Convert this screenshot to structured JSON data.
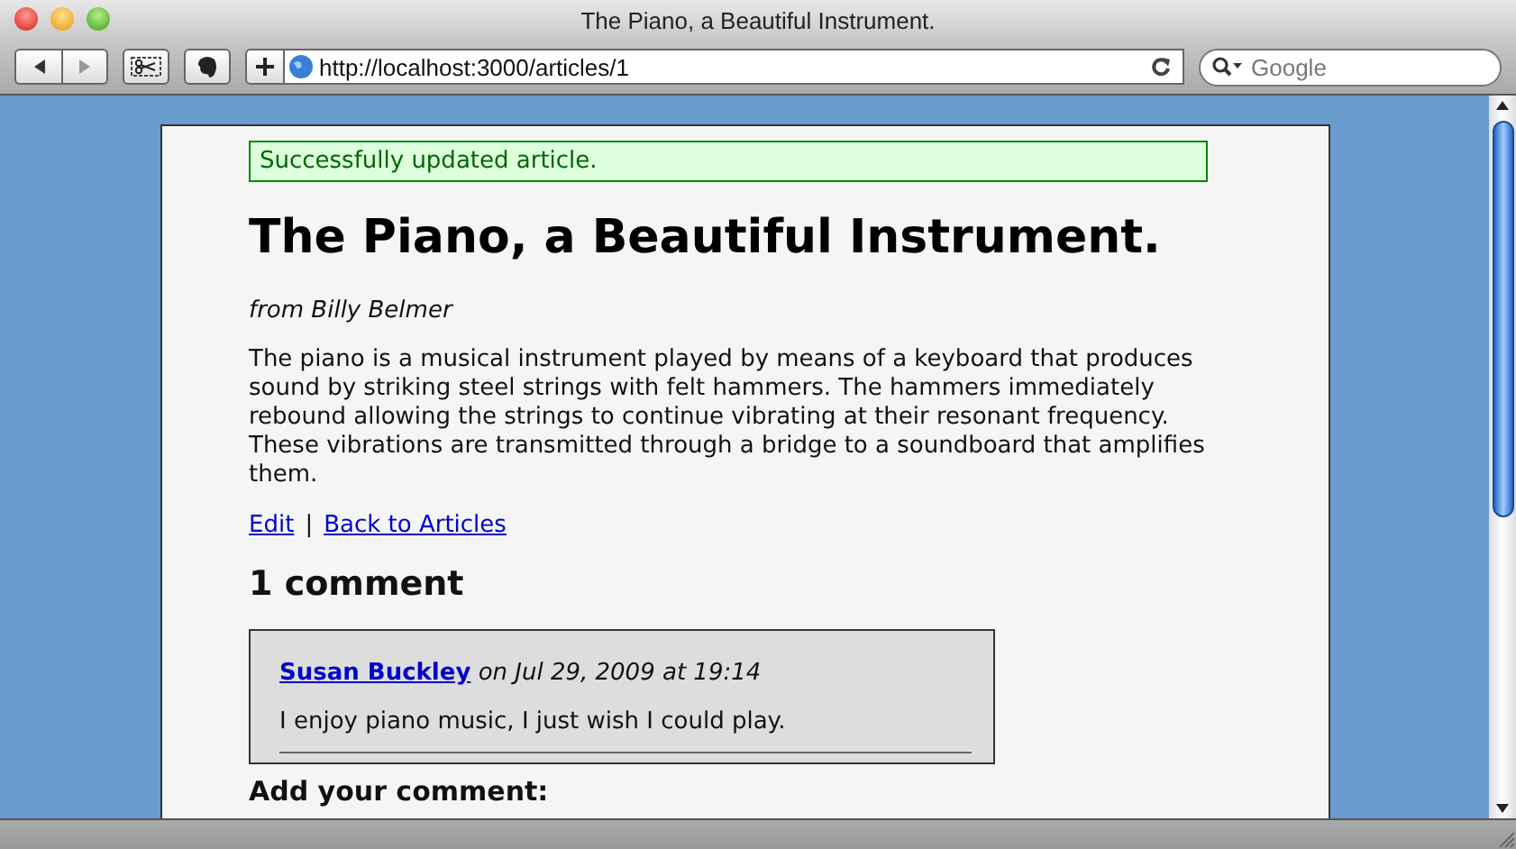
{
  "window": {
    "title": "The Piano, a Beautiful Instrument."
  },
  "toolbar": {
    "url": "http://localhost:3000/articles/1",
    "search": {
      "placeholder": "Google"
    }
  },
  "notice": "Successfully updated article.",
  "article": {
    "title": "The Piano, a Beautiful Instrument.",
    "byline": "from Billy Belmer",
    "body": "The piano is a musical instrument played by means of a keyboard that produces sound by striking steel strings with felt hammers. The hammers immediately rebound allowing the strings to continue vibrating at their resonant frequency. These vibrations are transmitted through a bridge to a soundboard that amplifies them."
  },
  "links": [
    {
      "label": "Edit"
    },
    {
      "label": "Back to Articles"
    }
  ],
  "link_separator": "|",
  "comments_heading": "1 comment",
  "comments": [
    {
      "author": "Susan Buckley",
      "date": "on Jul 29, 2009 at 19:14",
      "text": "I enjoy piano music, I just wish I could play."
    }
  ],
  "form_heading": "Add your comment:"
}
